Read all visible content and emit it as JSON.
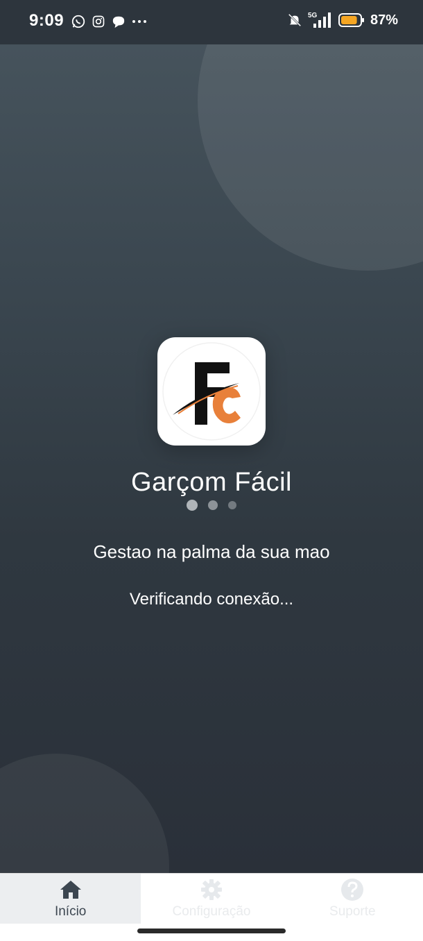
{
  "status_bar": {
    "time": "9:09",
    "left_icons": [
      "whatsapp-icon",
      "instagram-icon",
      "chat-bubble-icon",
      "more-dots-icon"
    ],
    "network": "5G",
    "battery_percent": "87%",
    "battery_level": 0.87,
    "battery_color": "#f5a623"
  },
  "splash": {
    "logo_letters": "FC",
    "logo_colors": {
      "f": "#111111",
      "c": "#e8803a"
    },
    "app_name": "Garçom Fácil",
    "tagline": "Gestao na palma da sua mao",
    "status_message": "Verificando conexão...",
    "loading_dots": 3
  },
  "bottom_nav": {
    "items": [
      {
        "label": "Início",
        "icon": "home-icon",
        "active": true
      },
      {
        "label": "Configuração",
        "icon": "gear-icon",
        "active": false
      },
      {
        "label": "Suporte",
        "icon": "help-icon",
        "active": false
      }
    ]
  },
  "colors": {
    "background_top": "#46535c",
    "background_bottom": "#2a3039",
    "accent": "#e8803a",
    "nav_active_bg": "#eceef0"
  }
}
